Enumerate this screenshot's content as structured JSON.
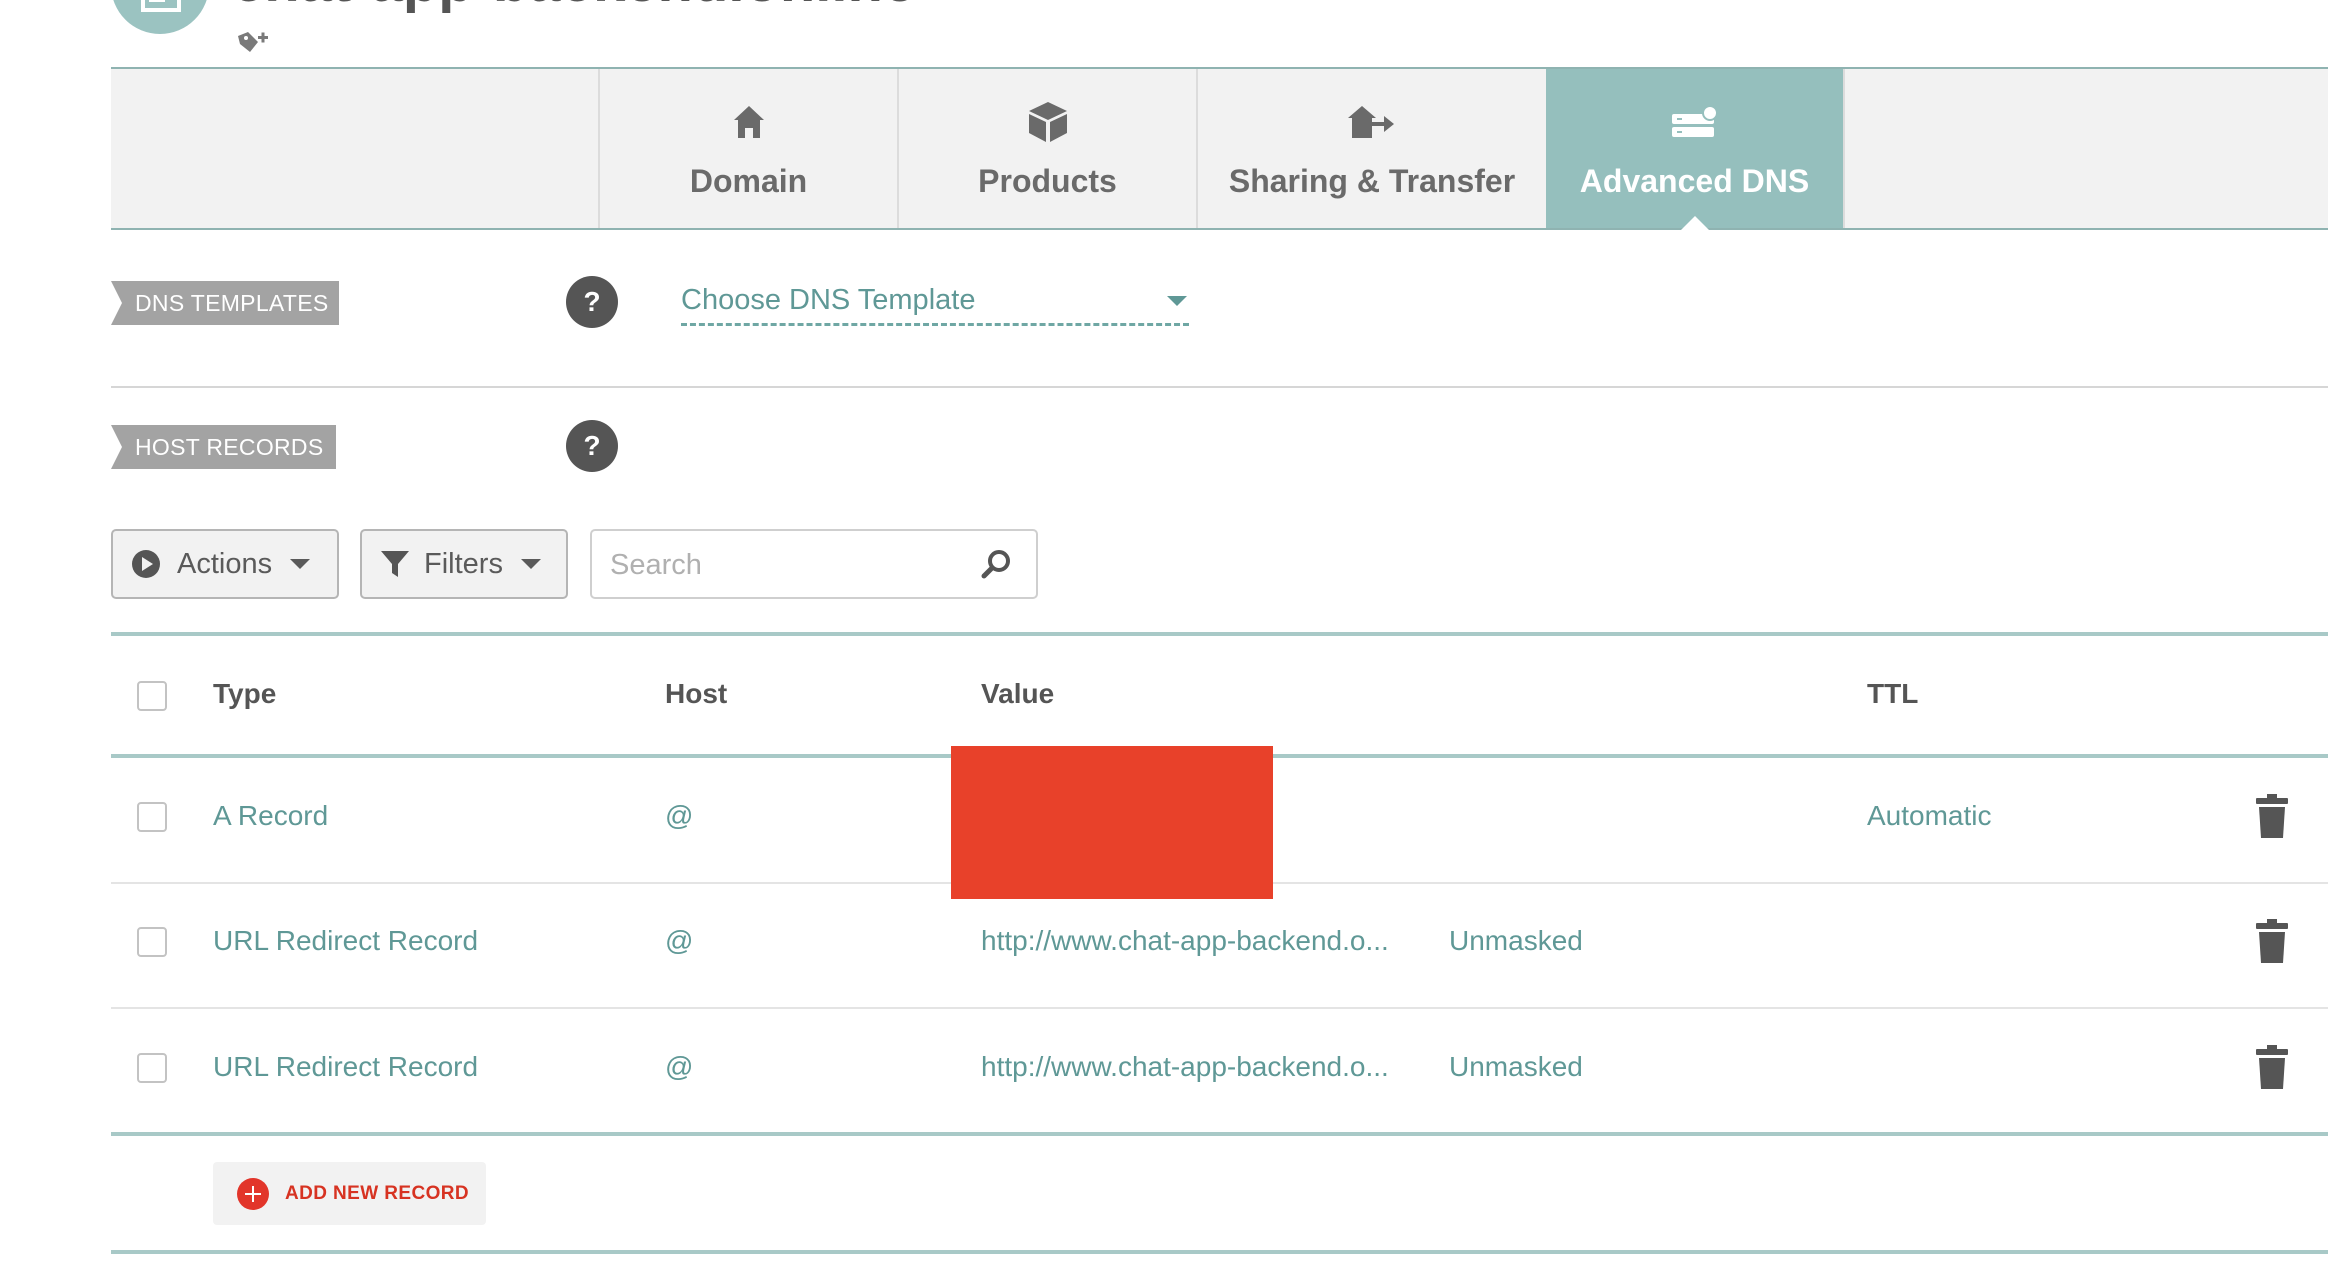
{
  "header": {
    "domain_title": "chat-app-backend.online",
    "avatar_icon": "computer-icon",
    "tag_icon": "add-tag-icon"
  },
  "tabs": [
    {
      "label": "Domain",
      "icon": "home-icon",
      "active": false
    },
    {
      "label": "Products",
      "icon": "box-icon",
      "active": false
    },
    {
      "label": "Sharing & Transfer",
      "icon": "transfer-icon",
      "active": false
    },
    {
      "label": "Advanced DNS",
      "icon": "server-icon",
      "active": true
    }
  ],
  "dns_templates": {
    "badge": "DNS TEMPLATES",
    "help": "?",
    "select_placeholder": "Choose DNS Template"
  },
  "host_records": {
    "badge": "HOST RECORDS",
    "help": "?"
  },
  "toolbar": {
    "actions_label": "Actions",
    "filters_label": "Filters",
    "search_placeholder": "Search"
  },
  "table": {
    "headers": {
      "type": "Type",
      "host": "Host",
      "value": "Value",
      "ttl": "TTL"
    },
    "rows": [
      {
        "type": "A Record",
        "host": "@",
        "value": "",
        "extra": "",
        "ttl": "Automatic"
      },
      {
        "type": "URL Redirect Record",
        "host": "@",
        "value": "http://www.chat-app-backend.o...",
        "extra": "Unmasked",
        "ttl": ""
      },
      {
        "type": "URL Redirect Record",
        "host": "@",
        "value": "http://www.chat-app-backend.o...",
        "extra": "Unmasked",
        "ttl": ""
      }
    ]
  },
  "add_record_label": "ADD NEW RECORD",
  "colors": {
    "accent": "#95bfbd",
    "link": "#5f9896",
    "danger": "#e2352a",
    "redaction": "#e8412a"
  }
}
